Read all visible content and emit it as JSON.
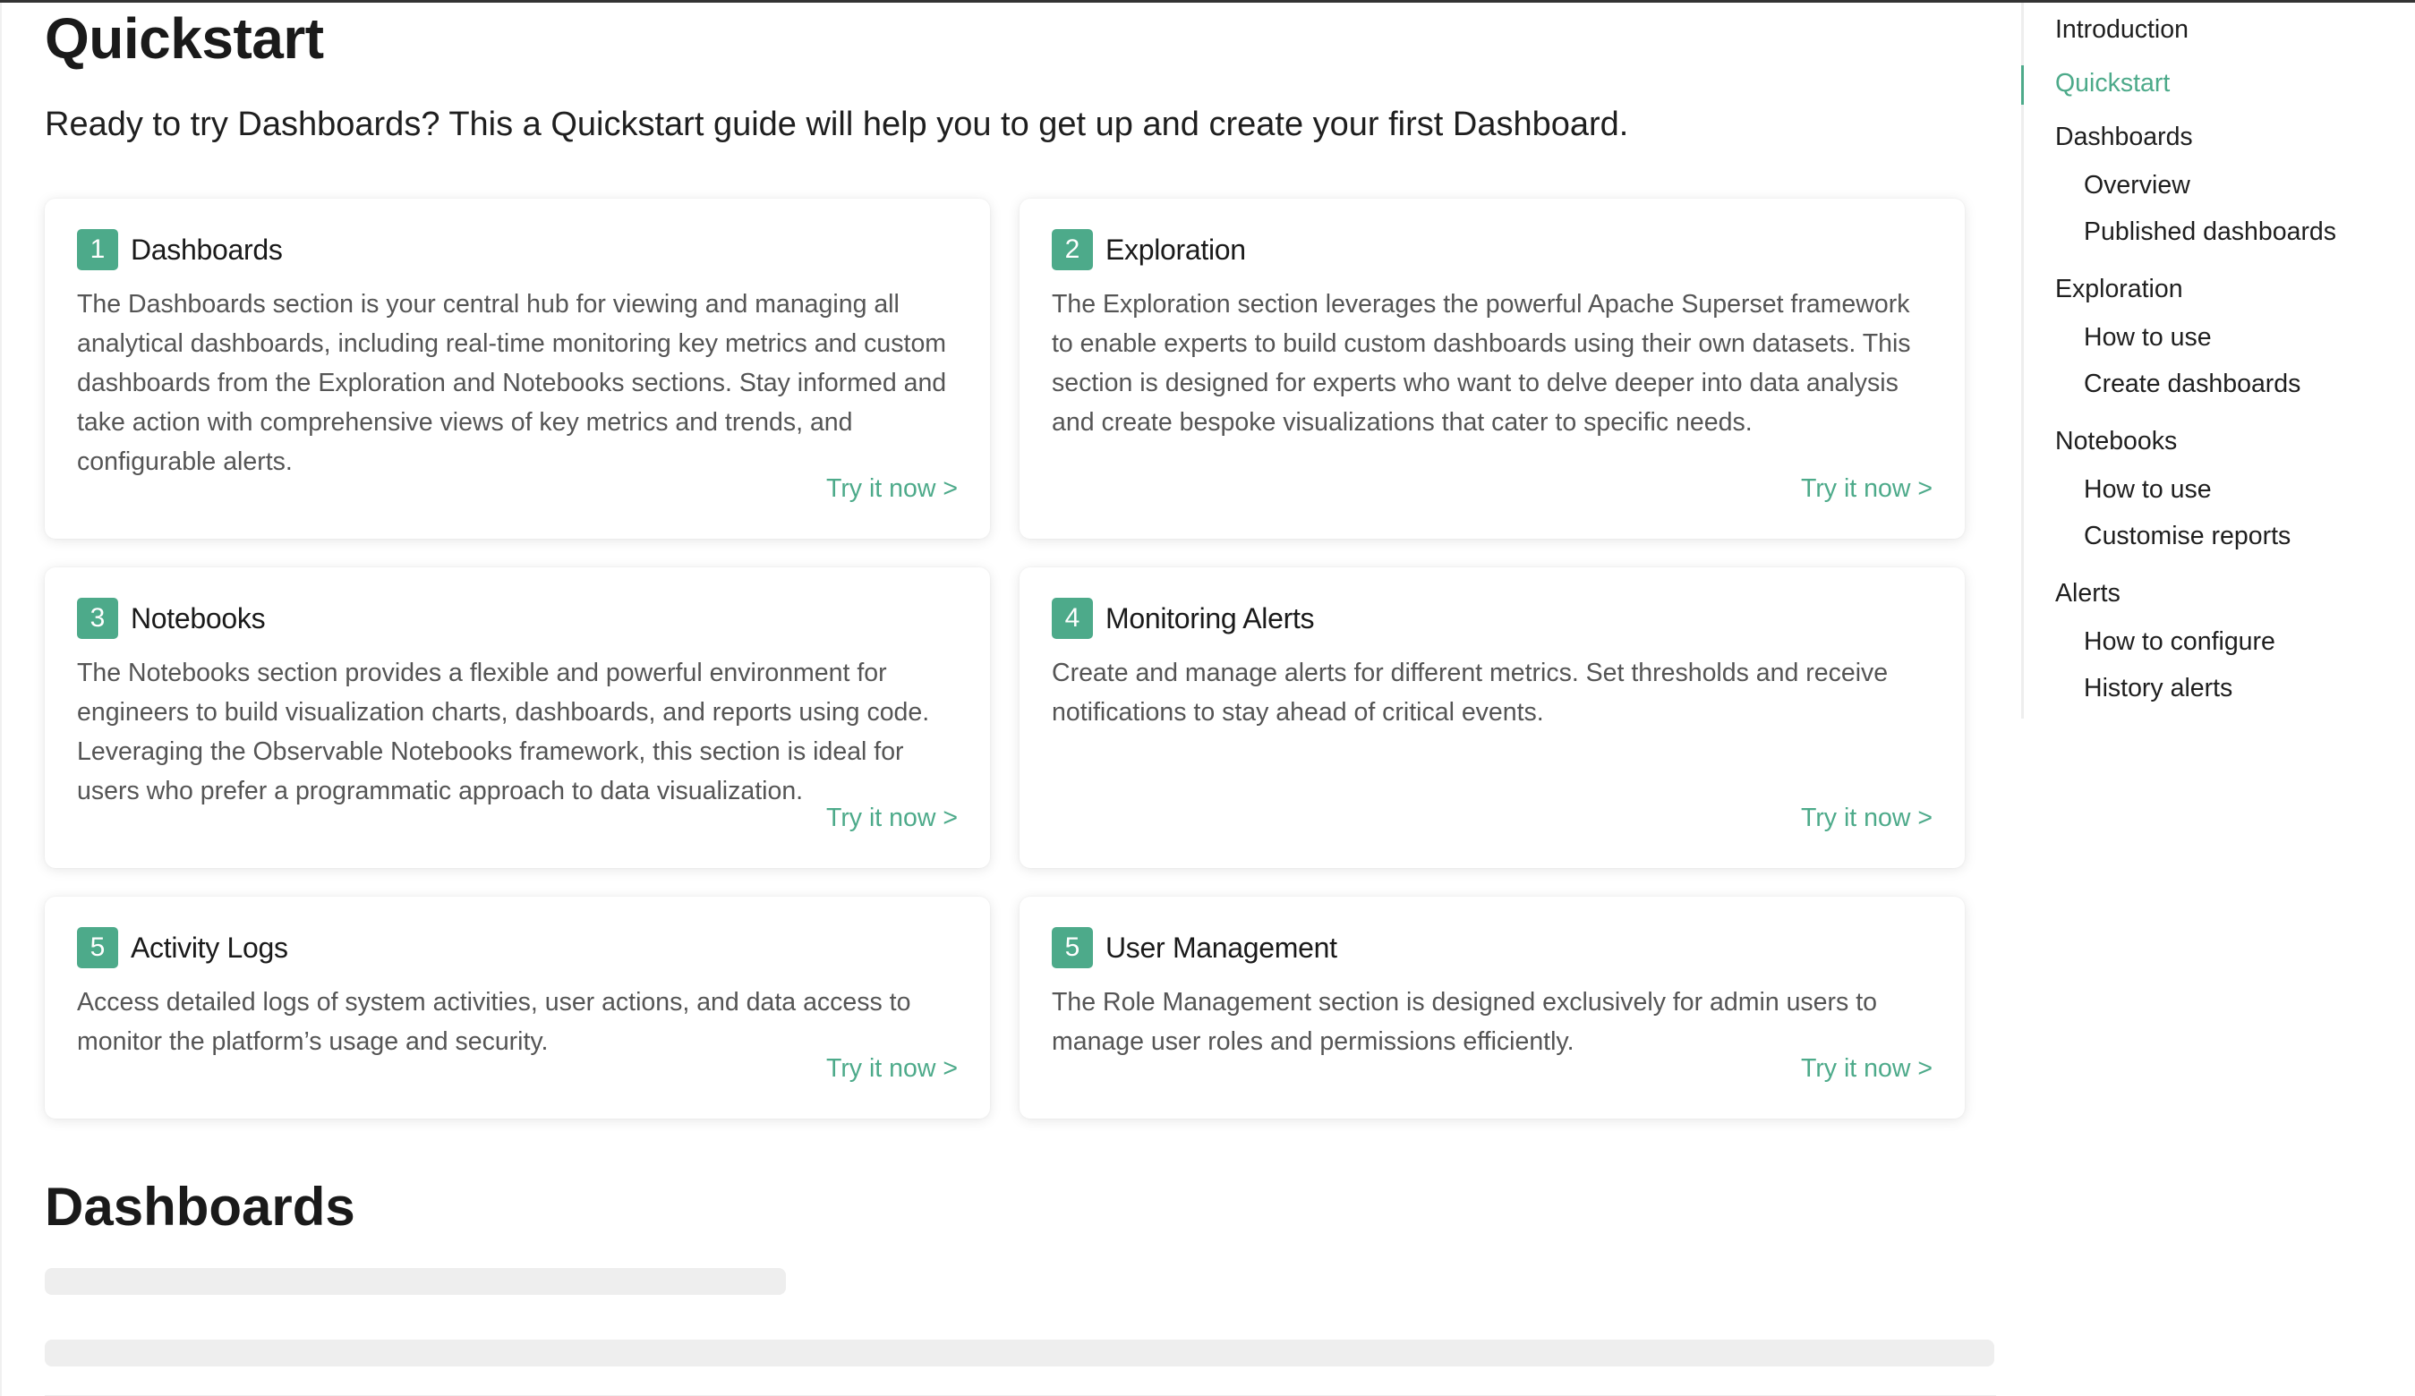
{
  "page": {
    "title": "Quickstart",
    "intro": "Ready to try Dashboards? This a Quickstart guide will help you to get up and create your first Dashboard."
  },
  "cards": [
    {
      "number": "1",
      "title": "Dashboards",
      "body": "The Dashboards section is your central hub for viewing and managing all analytical dashboards, including real-time monitoring key metrics and custom dashboards from the Exploration and Notebooks sections. Stay informed and take action with comprehensive views of key metrics and trends, and configurable alerts.",
      "link": "Try it now >"
    },
    {
      "number": "2",
      "title": "Exploration",
      "body": "The Exploration section leverages the powerful Apache Superset framework to enable experts to build custom dashboards using their own datasets. This section is designed for experts who want to delve deeper into data analysis and create bespoke visualizations that cater to specific needs.",
      "link": "Try it now >"
    },
    {
      "number": "3",
      "title": "Notebooks",
      "body": "The Notebooks section provides a flexible and powerful environment for engineers to build visualization charts, dashboards, and reports using code. Leveraging the Observable Notebooks framework, this section is ideal for users who prefer a programmatic approach to data visualization.",
      "link": "Try it now >"
    },
    {
      "number": "4",
      "title": "Monitoring Alerts",
      "body": "Create and manage alerts for different metrics. Set thresholds and receive notifications to stay ahead of critical events.",
      "link": "Try it now >"
    },
    {
      "number": "5",
      "title": "Activity Logs",
      "body": "Access detailed logs of system activities, user actions, and data access to monitor the platform’s usage and security.",
      "link": "Try it now >"
    },
    {
      "number": "5",
      "title": "User Management",
      "body": "The Role Management section is designed exclusively for admin users to manage user roles and permissions efficiently.",
      "link": "Try it now >"
    }
  ],
  "section": {
    "title": "Dashboards"
  },
  "toc": {
    "items": [
      {
        "label": "Introduction",
        "level": 1
      },
      {
        "label": "Quickstart",
        "level": 1,
        "active": true
      },
      {
        "label": "Dashboards",
        "level": 1
      },
      {
        "label": "Overview",
        "level": 2
      },
      {
        "label": "Published dashboards",
        "level": 2
      },
      {
        "label": "Exploration",
        "level": 1
      },
      {
        "label": "How to use",
        "level": 2
      },
      {
        "label": "Create dashboards",
        "level": 2
      },
      {
        "label": "Notebooks",
        "level": 1
      },
      {
        "label": "How to use",
        "level": 2
      },
      {
        "label": "Customise reports",
        "level": 2
      },
      {
        "label": "Alerts",
        "level": 1
      },
      {
        "label": "How to configure",
        "level": 2
      },
      {
        "label": "History alerts",
        "level": 2
      }
    ]
  },
  "colors": {
    "accent": "#4daa8a",
    "text": "#1f1f1f",
    "muted": "#555555"
  }
}
